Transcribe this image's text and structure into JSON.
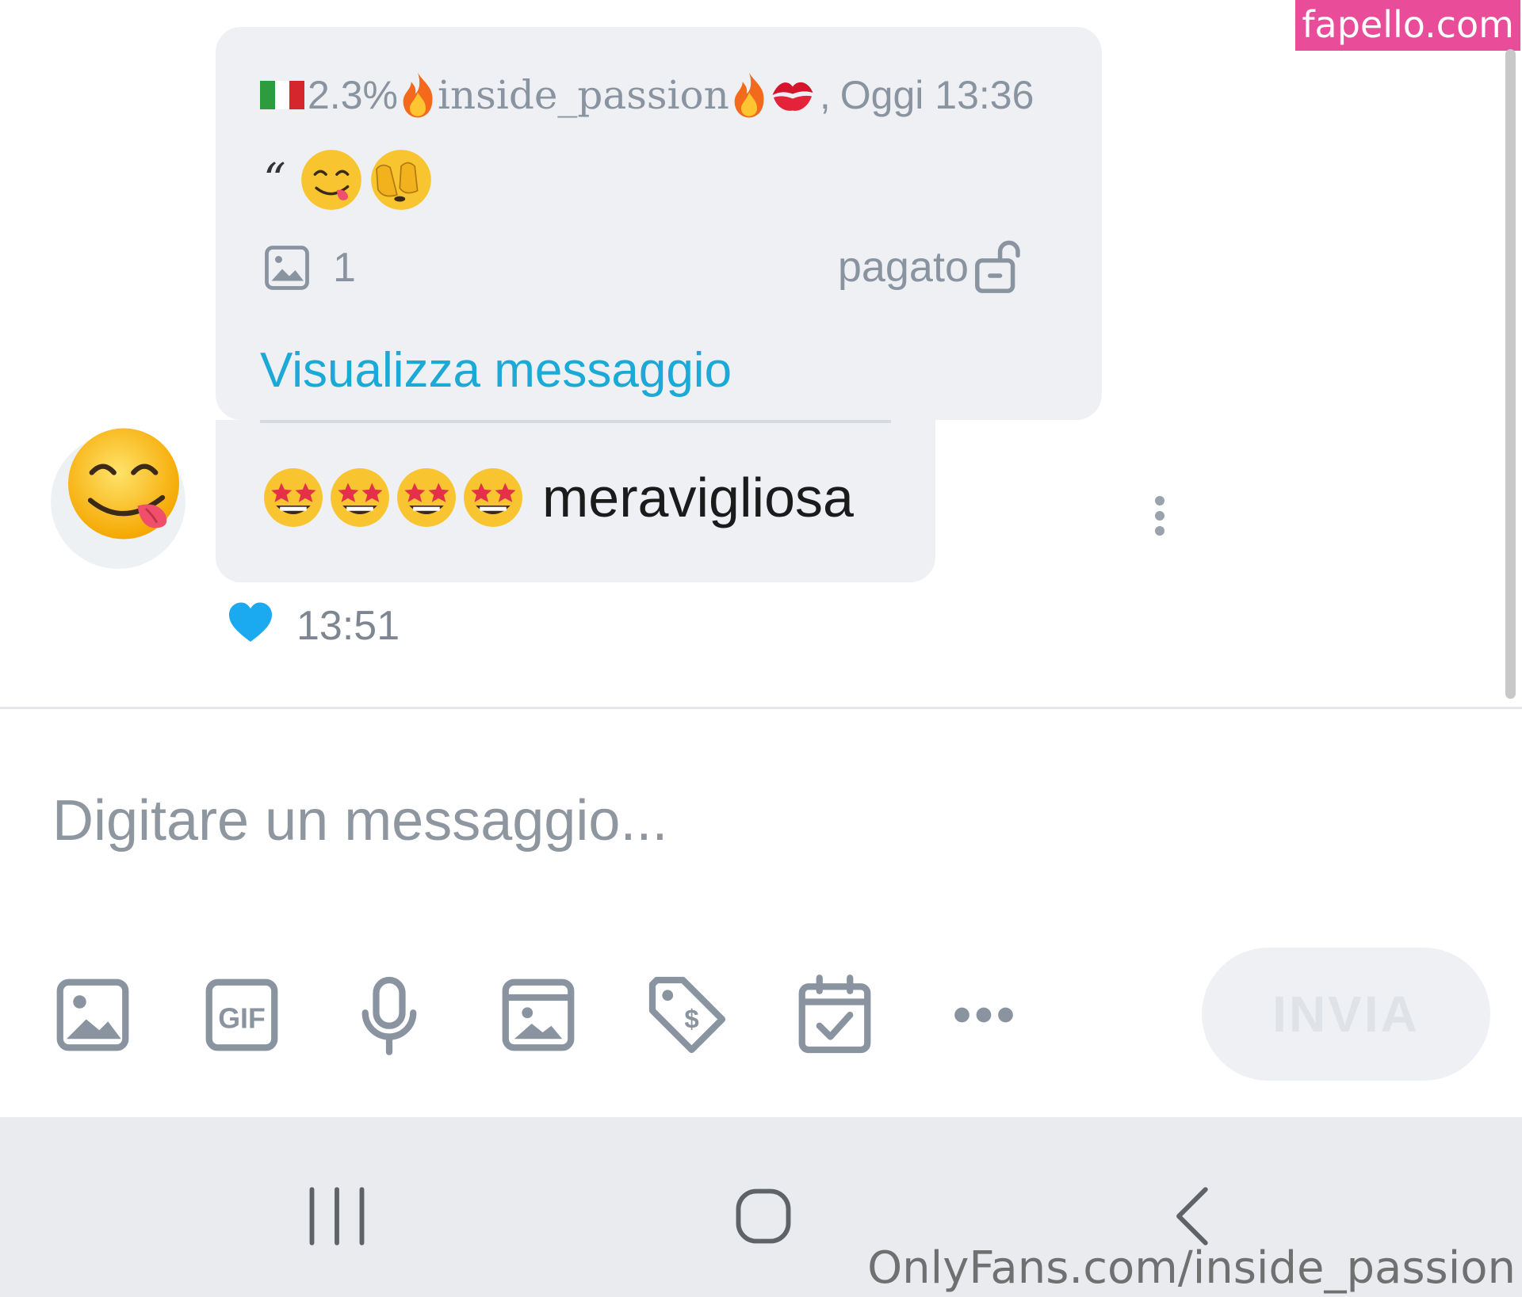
{
  "watermark": {
    "top": "fapello.com",
    "bottom": "OnlyFans.com/inside_passion"
  },
  "quoted_message": {
    "flag": "italy-flag-icon",
    "percentage": "2.3%",
    "username": "inside_passion",
    "separator": ",",
    "timestamp": "Oggi 13:36",
    "quote_mark": "“",
    "emojis": [
      "face-savoring-food-emoji",
      "face-with-peeking-eye-emoji"
    ],
    "media_count": "1",
    "paid_label": "pagato",
    "view_link": "Visualizza messaggio"
  },
  "reply_message": {
    "emojis": [
      "star-struck-emoji",
      "star-struck-emoji",
      "star-struck-emoji",
      "star-struck-emoji"
    ],
    "text": "meravigliosa",
    "time": "13:51",
    "liked": true
  },
  "composer": {
    "placeholder": "Digitare un messaggio...",
    "value": "",
    "send_label": "INVIA"
  },
  "toolbar": [
    "image-icon",
    "gif-icon",
    "microphone-icon",
    "vault-icon",
    "price-tag-icon",
    "calendar-check-icon",
    "more-icon"
  ],
  "colors": {
    "accent": "#1ba9d8",
    "bubble": "#eef0f3",
    "muted_text": "#8a94a0",
    "watermark_bg": "#e94d9a"
  }
}
